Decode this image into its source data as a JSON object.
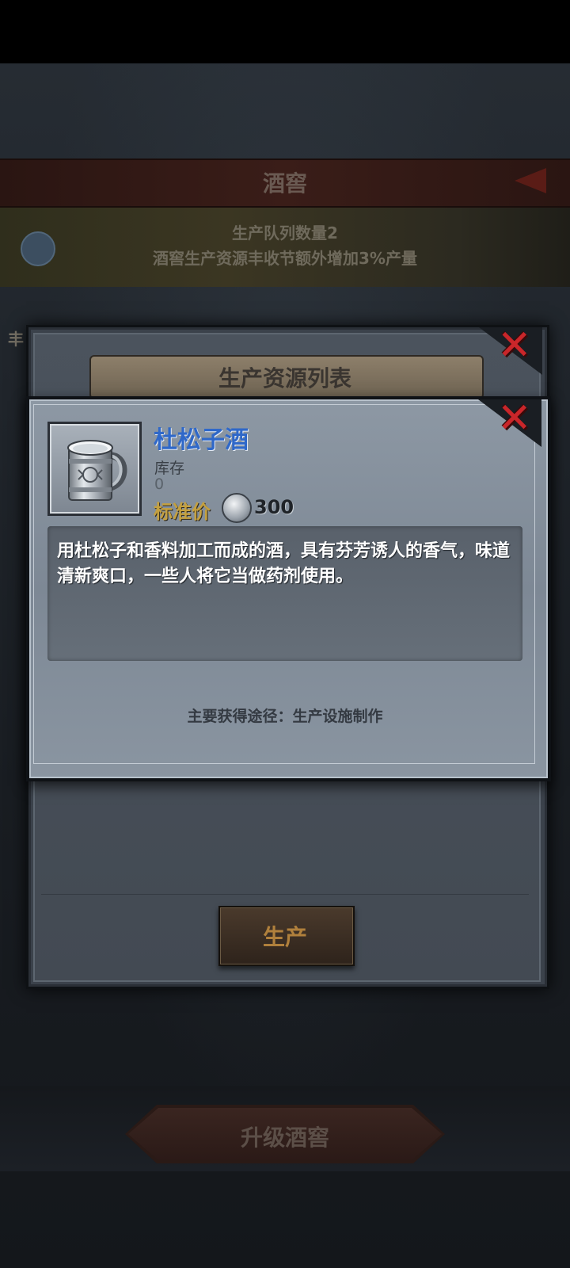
{
  "background": {
    "title": "酒窖",
    "info_lines": [
      "生产队列数量2",
      "酒窖生产资源丰收节额外增加3%产量"
    ],
    "side_label": "丰",
    "upgrade_button": "升级酒窖"
  },
  "list_modal": {
    "title": "生产资源列表",
    "produce_button": "生产",
    "close_icon": "close-x-icon"
  },
  "detail": {
    "name": "杜松子酒",
    "stock_label": "库存",
    "stock_value": "0",
    "price_label": "标准价",
    "price_value": "300",
    "description": "用杜松子和香料加工而成的酒，具有芬芳诱人的香气，味道清新爽口，一些人将它当做药剂使用。",
    "source": "主要获得途径：生产设施制作",
    "icon": "pewter-mug-icon",
    "coin_icon": "silver-coin-icon"
  },
  "colors": {
    "item_name": "#2f68c9",
    "price_label": "#c4a040",
    "close_x": "#c9262a",
    "produce_label": "#b0803c"
  }
}
